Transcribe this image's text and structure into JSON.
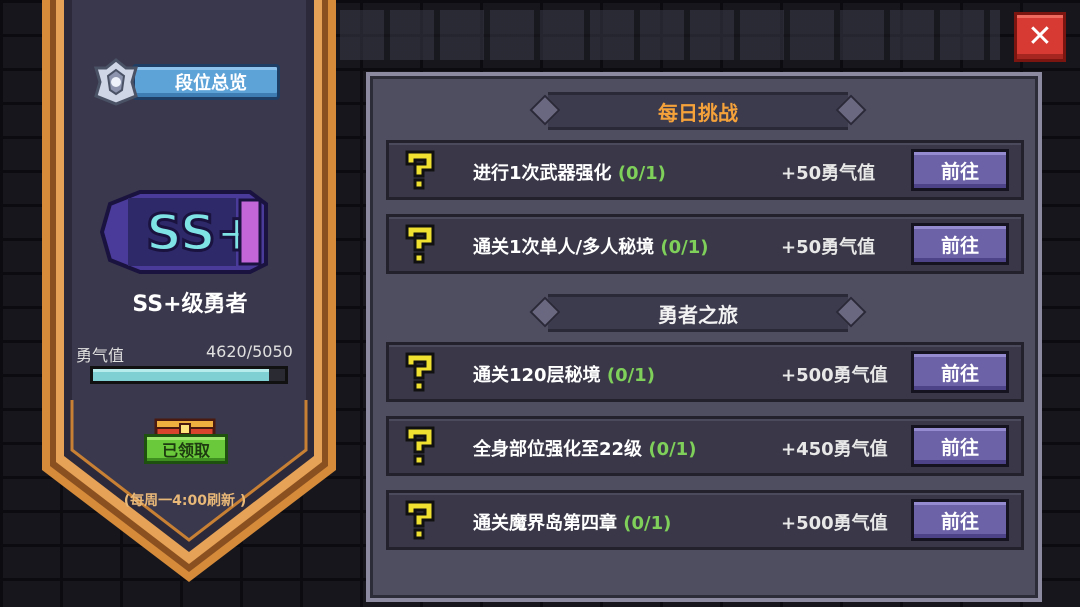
{
  "close": {
    "label": "✕"
  },
  "banner": {
    "rank_overview_label": "段位总览",
    "rank_badge_text": "SS+",
    "rank_title": "SS+级勇者",
    "courage_label": "勇气值",
    "courage_value": "4620/5050",
    "courage_progress": 0.915,
    "claimed_label": "已领取",
    "refresh_note": "(每周一4:00刷新 )"
  },
  "daily": {
    "title": "每日挑战",
    "tasks": [
      {
        "name": "进行1次武器强化",
        "progress": "(0/1)",
        "reward": "+50勇气值",
        "button": "前往"
      },
      {
        "name": "通关1次单人/多人秘境",
        "progress": "(0/1)",
        "reward": "+50勇气值",
        "button": "前往"
      }
    ]
  },
  "journey": {
    "title": "勇者之旅",
    "tasks": [
      {
        "name": "通关120层秘境",
        "progress": "(0/1)",
        "reward": "+500勇气值",
        "button": "前往"
      },
      {
        "name": "全身部位强化至22级",
        "progress": "(0/1)",
        "reward": "+450勇气值",
        "button": "前往"
      },
      {
        "name": "通关魔界岛第四章",
        "progress": "(0/1)",
        "reward": "+500勇气值",
        "button": "前往"
      }
    ]
  },
  "colors": {
    "accent_orange": "#f6a23a",
    "progress_green": "#7ed05a",
    "button_purple": "#6c62a8",
    "close_red": "#d63a32"
  }
}
